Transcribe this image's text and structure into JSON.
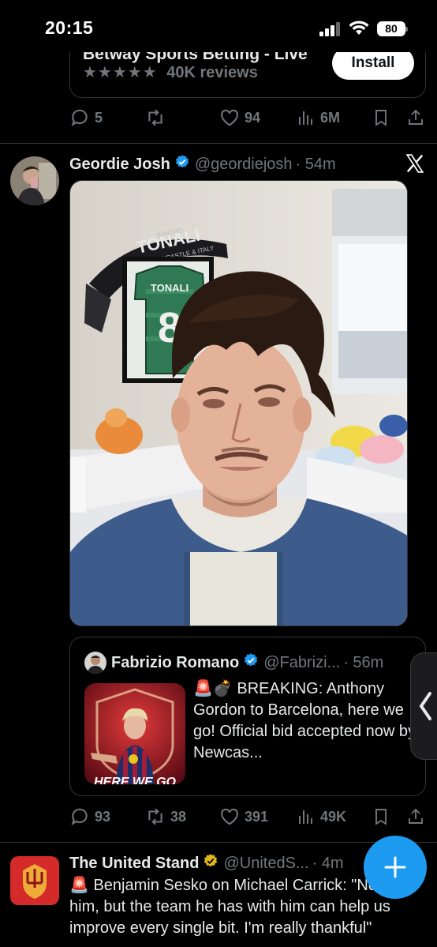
{
  "status_bar": {
    "time": "20:15",
    "battery": "80"
  },
  "ad": {
    "app_name": "Betway Sports Betting - Live",
    "stars": "★★★★★",
    "reviews": "40K reviews",
    "install_label": "Install",
    "actions": {
      "replies": "5",
      "likes": "94",
      "views": "6M"
    }
  },
  "tweet": {
    "author_name": "Geordie Josh",
    "handle": "@geordiejosh",
    "time": "· 54m",
    "media_text": {
      "scarf": "TONALI",
      "scarf_small": "SANDRO",
      "scarf_sub": "NEWCASTLE & ITALY",
      "shirt_name": "TONALI",
      "shirt_number": "8"
    },
    "quote": {
      "author_name": "Fabrizio Romano",
      "handle": "@Fabrizi...",
      "time": "· 56m",
      "text": "🚨💣 BREAKING: Anthony Gordon to Barcelona, here we go! Official bid accepted now by Newcas...",
      "thumb_caption": "HERE WE GO"
    },
    "actions": {
      "replies": "93",
      "reposts": "38",
      "likes": "391",
      "views": "49K"
    }
  },
  "next_tweet": {
    "author_name": "The United Stand",
    "handle": "@UnitedS...",
    "time": "· 4m",
    "text": "🚨 Benjamin Sesko on Michael Carrick: \"Not just him, but the team he has with him can help us improve every single bit. I'm really thankful\""
  },
  "colors": {
    "accent": "#1d9bf0",
    "verified_gold": "#e2b719",
    "muted": "#71767b",
    "background": "#000000"
  },
  "icons": [
    "signal-icon",
    "wifi-icon",
    "battery-icon",
    "reply-icon",
    "repost-icon",
    "like-icon",
    "views-icon",
    "bookmark-icon",
    "share-icon",
    "verified-badge-icon",
    "x-logo-icon",
    "compose-icon",
    "chevron-left-icon"
  ]
}
